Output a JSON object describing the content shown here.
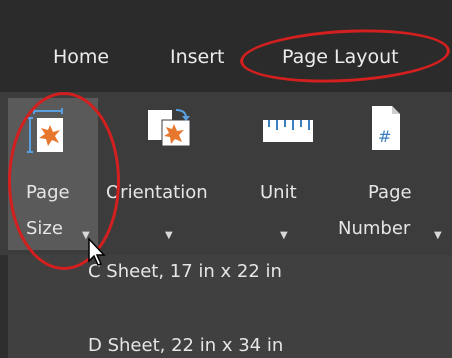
{
  "tabs": [
    {
      "label": "Home"
    },
    {
      "label": "Insert"
    },
    {
      "label": "Page Layout"
    }
  ],
  "ribbon": {
    "page_size": {
      "line1": "Page",
      "line2": "Size"
    },
    "orientation": {
      "line1": "Orientation"
    },
    "unit": {
      "line1": "Unit"
    },
    "page_number": {
      "line1": "Page",
      "line2": "Number"
    }
  },
  "menu": {
    "items": [
      "C Sheet, 17 in x 22 in",
      "D Sheet, 22 in x 34 in"
    ]
  },
  "colors": {
    "highlight": "#d41f1f",
    "icon_orange": "#e8772e",
    "icon_blue": "#5aa0e0"
  }
}
